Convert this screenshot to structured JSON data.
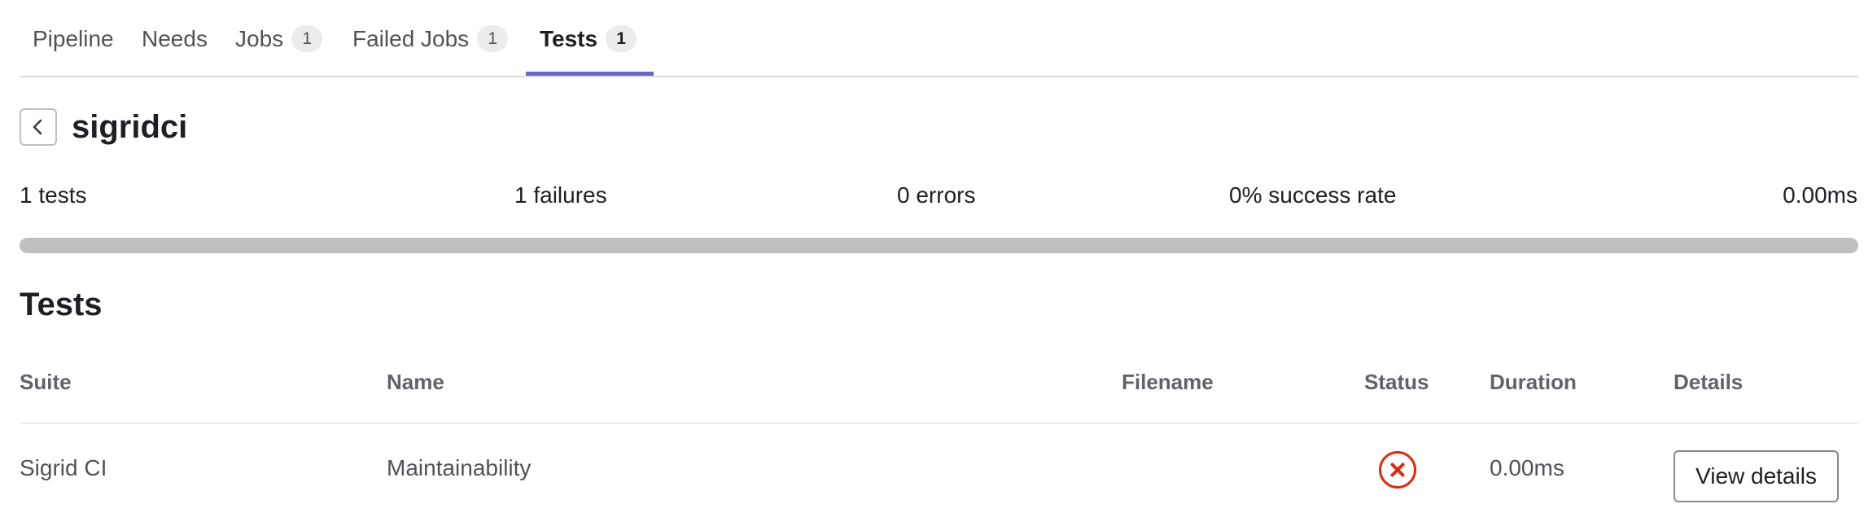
{
  "tabs": [
    {
      "label": "Pipeline"
    },
    {
      "label": "Needs"
    },
    {
      "label": "Jobs",
      "count": "1"
    },
    {
      "label": "Failed Jobs",
      "count": "1"
    },
    {
      "label": "Tests",
      "count": "1",
      "active": true
    }
  ],
  "suite": {
    "name": "sigridci"
  },
  "summary": {
    "tests": "1 tests",
    "failures": "1 failures",
    "errors": "0 errors",
    "success_rate": "0% success rate",
    "duration": "0.00ms",
    "success_fraction": 0
  },
  "tests_section": {
    "title": "Tests",
    "columns": {
      "suite": "Suite",
      "name": "Name",
      "filename": "Filename",
      "status": "Status",
      "duration": "Duration",
      "details": "Details"
    },
    "rows": [
      {
        "suite": "Sigrid CI",
        "name": "Maintainability",
        "filename": "",
        "status": "failed",
        "duration": "0.00ms",
        "details_label": "View details"
      }
    ]
  },
  "icons": {
    "back": "chevron-left-icon",
    "status_failed": "status-failed-icon"
  },
  "colors": {
    "tab_active_underline": "#6666c4",
    "status_failed": "#dd2b0e",
    "progress_track": "#bfbfbf",
    "progress_success": "#108548"
  }
}
